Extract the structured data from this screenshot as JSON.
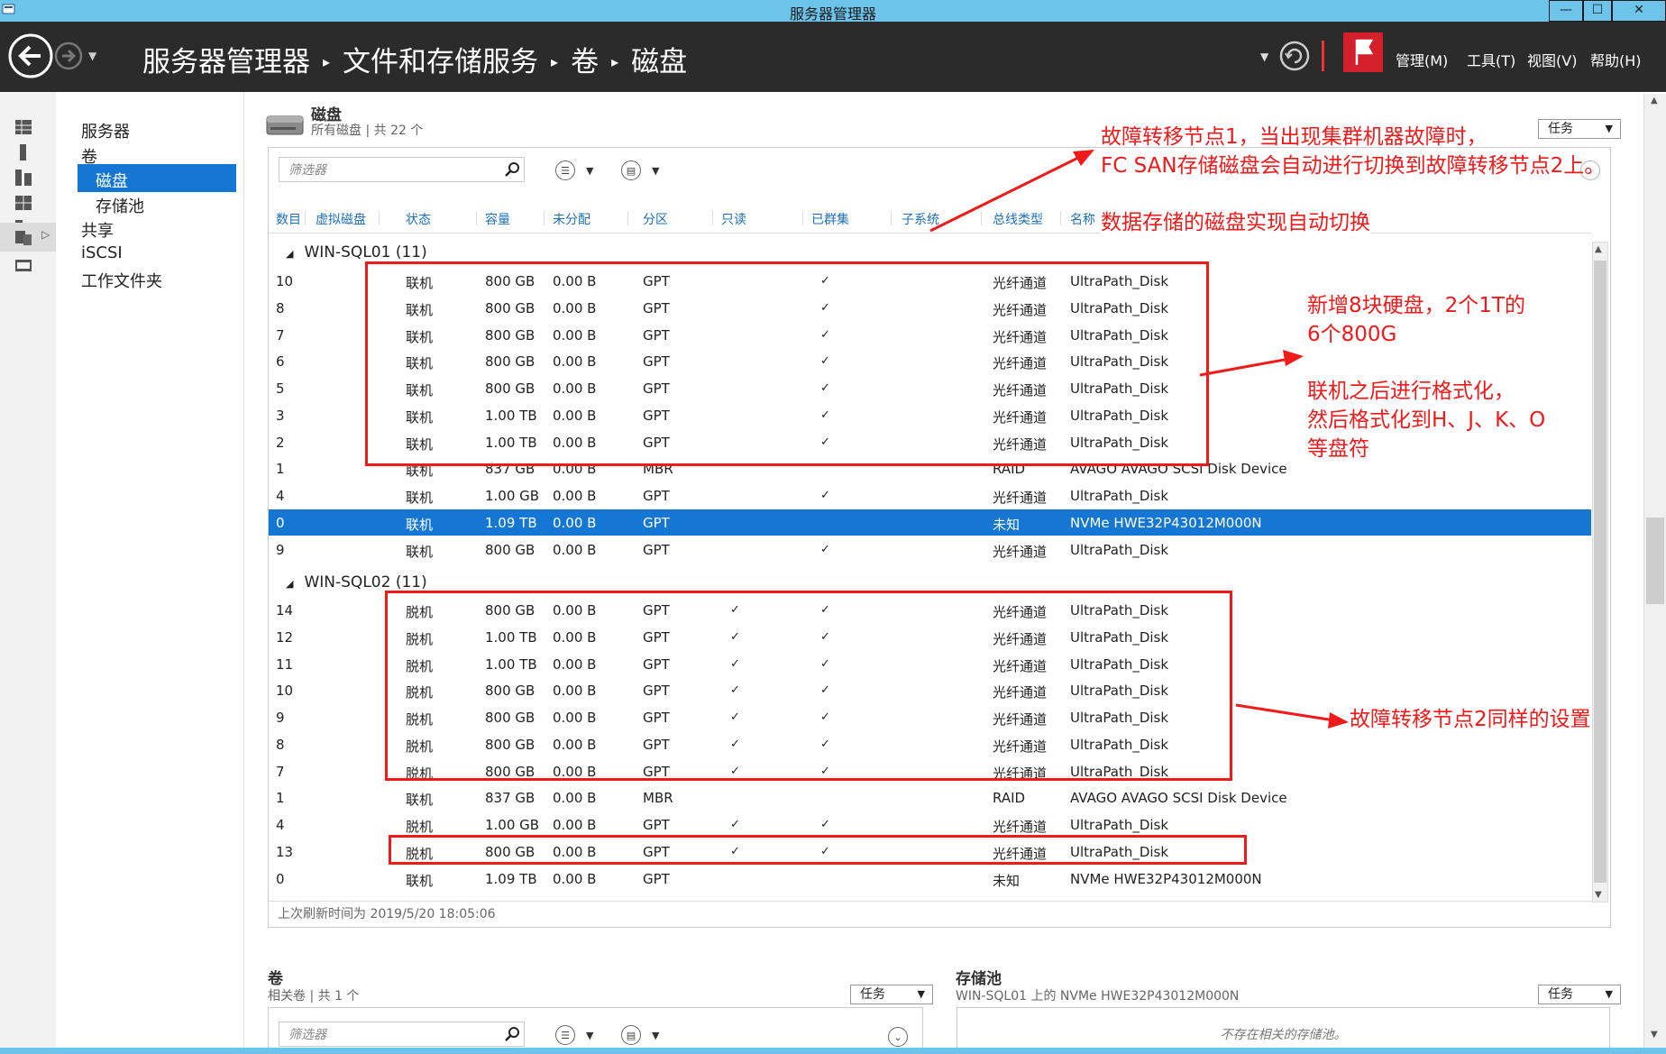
{
  "window": {
    "title": "服务器管理器",
    "min": "—",
    "max": "☐",
    "close": "✕"
  },
  "header": {
    "breadcrumb": [
      "服务器管理器",
      "文件和存储服务",
      "卷",
      "磁盘"
    ],
    "separator": "▸",
    "menus": [
      "管理(M)",
      "工具(T)",
      "视图(V)",
      "帮助(H)"
    ]
  },
  "nav": {
    "items": [
      {
        "label": "服务器"
      },
      {
        "label": "卷"
      },
      {
        "label": "磁盘"
      },
      {
        "label": "存储池"
      },
      {
        "label": "共享"
      },
      {
        "label": "iSCSI"
      },
      {
        "label": "工作文件夹"
      }
    ]
  },
  "disks": {
    "title": "磁盘",
    "subtitle": "所有磁盘 | 共 22 个",
    "tasks_label": "任务",
    "filter_placeholder": "筛选器",
    "columns": [
      "数目",
      "虚拟磁盘",
      "状态",
      "容量",
      "未分配",
      "分区",
      "只读",
      "已群集",
      "子系统",
      "总线类型",
      "名称"
    ],
    "groups": [
      {
        "label": "WIN-SQL01 (11)",
        "rows": [
          {
            "num": "10",
            "status": "联机",
            "cap": "800 GB",
            "unalloc": "0.00 B",
            "part": "GPT",
            "ro": "",
            "clustered": "✓",
            "bus": "光纤通道",
            "name": "UltraPath_Disk"
          },
          {
            "num": "8",
            "status": "联机",
            "cap": "800 GB",
            "unalloc": "0.00 B",
            "part": "GPT",
            "ro": "",
            "clustered": "✓",
            "bus": "光纤通道",
            "name": "UltraPath_Disk"
          },
          {
            "num": "7",
            "status": "联机",
            "cap": "800 GB",
            "unalloc": "0.00 B",
            "part": "GPT",
            "ro": "",
            "clustered": "✓",
            "bus": "光纤通道",
            "name": "UltraPath_Disk"
          },
          {
            "num": "6",
            "status": "联机",
            "cap": "800 GB",
            "unalloc": "0.00 B",
            "part": "GPT",
            "ro": "",
            "clustered": "✓",
            "bus": "光纤通道",
            "name": "UltraPath_Disk"
          },
          {
            "num": "5",
            "status": "联机",
            "cap": "800 GB",
            "unalloc": "0.00 B",
            "part": "GPT",
            "ro": "",
            "clustered": "✓",
            "bus": "光纤通道",
            "name": "UltraPath_Disk"
          },
          {
            "num": "3",
            "status": "联机",
            "cap": "1.00 TB",
            "unalloc": "0.00 B",
            "part": "GPT",
            "ro": "",
            "clustered": "✓",
            "bus": "光纤通道",
            "name": "UltraPath_Disk"
          },
          {
            "num": "2",
            "status": "联机",
            "cap": "1.00 TB",
            "unalloc": "0.00 B",
            "part": "GPT",
            "ro": "",
            "clustered": "✓",
            "bus": "光纤通道",
            "name": "UltraPath_Disk"
          },
          {
            "num": "1",
            "status": "联机",
            "cap": "837 GB",
            "unalloc": "0.00 B",
            "part": "MBR",
            "ro": "",
            "clustered": "",
            "bus": "RAID",
            "name": "AVAGO AVAGO SCSI Disk Device"
          },
          {
            "num": "4",
            "status": "联机",
            "cap": "1.00 GB",
            "unalloc": "0.00 B",
            "part": "GPT",
            "ro": "",
            "clustered": "✓",
            "bus": "光纤通道",
            "name": "UltraPath_Disk"
          },
          {
            "num": "0",
            "status": "联机",
            "cap": "1.09 TB",
            "unalloc": "0.00 B",
            "part": "GPT",
            "ro": "",
            "clustered": "",
            "bus": "未知",
            "name": "NVMe HWE32P43012M000N",
            "selected": true
          },
          {
            "num": "9",
            "status": "联机",
            "cap": "800 GB",
            "unalloc": "0.00 B",
            "part": "GPT",
            "ro": "",
            "clustered": "✓",
            "bus": "光纤通道",
            "name": "UltraPath_Disk"
          }
        ]
      },
      {
        "label": "WIN-SQL02 (11)",
        "rows": [
          {
            "num": "14",
            "status": "脱机",
            "cap": "800 GB",
            "unalloc": "0.00 B",
            "part": "GPT",
            "ro": "✓",
            "clustered": "✓",
            "bus": "光纤通道",
            "name": "UltraPath_Disk"
          },
          {
            "num": "12",
            "status": "脱机",
            "cap": "1.00 TB",
            "unalloc": "0.00 B",
            "part": "GPT",
            "ro": "✓",
            "clustered": "✓",
            "bus": "光纤通道",
            "name": "UltraPath_Disk"
          },
          {
            "num": "11",
            "status": "脱机",
            "cap": "1.00 TB",
            "unalloc": "0.00 B",
            "part": "GPT",
            "ro": "✓",
            "clustered": "✓",
            "bus": "光纤通道",
            "name": "UltraPath_Disk"
          },
          {
            "num": "10",
            "status": "脱机",
            "cap": "800 GB",
            "unalloc": "0.00 B",
            "part": "GPT",
            "ro": "✓",
            "clustered": "✓",
            "bus": "光纤通道",
            "name": "UltraPath_Disk"
          },
          {
            "num": "9",
            "status": "脱机",
            "cap": "800 GB",
            "unalloc": "0.00 B",
            "part": "GPT",
            "ro": "✓",
            "clustered": "✓",
            "bus": "光纤通道",
            "name": "UltraPath_Disk"
          },
          {
            "num": "8",
            "status": "脱机",
            "cap": "800 GB",
            "unalloc": "0.00 B",
            "part": "GPT",
            "ro": "✓",
            "clustered": "✓",
            "bus": "光纤通道",
            "name": "UltraPath_Disk"
          },
          {
            "num": "7",
            "status": "脱机",
            "cap": "800 GB",
            "unalloc": "0.00 B",
            "part": "GPT",
            "ro": "✓",
            "clustered": "✓",
            "bus": "光纤通道",
            "name": "UltraPath_Disk"
          },
          {
            "num": "1",
            "status": "联机",
            "cap": "837 GB",
            "unalloc": "0.00 B",
            "part": "MBR",
            "ro": "",
            "clustered": "",
            "bus": "RAID",
            "name": "AVAGO AVAGO SCSI Disk Device"
          },
          {
            "num": "4",
            "status": "脱机",
            "cap": "1.00 GB",
            "unalloc": "0.00 B",
            "part": "GPT",
            "ro": "✓",
            "clustered": "✓",
            "bus": "光纤通道",
            "name": "UltraPath_Disk"
          },
          {
            "num": "13",
            "status": "脱机",
            "cap": "800 GB",
            "unalloc": "0.00 B",
            "part": "GPT",
            "ro": "✓",
            "clustered": "✓",
            "bus": "光纤通道",
            "name": "UltraPath_Disk"
          },
          {
            "num": "0",
            "status": "联机",
            "cap": "1.09 TB",
            "unalloc": "0.00 B",
            "part": "GPT",
            "ro": "",
            "clustered": "",
            "bus": "未知",
            "name": "NVMe HWE32P43012M000N"
          }
        ]
      }
    ],
    "last_refresh": "上次刷新时间为 2019/5/20 18:05:06"
  },
  "volumes": {
    "title": "卷",
    "subtitle": "相关卷 | 共 1 个",
    "tasks_label": "任务",
    "filter_placeholder": "筛选器"
  },
  "storage_pool": {
    "title": "存储池",
    "subtitle": "WIN-SQL01 上的 NVMe HWE32P43012M000N",
    "tasks_label": "任务",
    "empty_message": "不存在相关的存储池。"
  },
  "annotations": {
    "a1_line1": "故障转移节点1，当出现集群机器故障时，",
    "a1_line2": "FC SAN存储磁盘会自动进行切换到故障转移节点2上。",
    "a2": "数据存储的磁盘实现自动切换",
    "a3_line1": "新增8块硬盘，2个1T的",
    "a3_line2": "6个800G",
    "a4_line1": "联机之后进行格式化，",
    "a4_line2": "然后格式化到H、J、K、O",
    "a4_line3": "等盘符",
    "a5": "故障转移节点2同样的设置"
  },
  "colors": {
    "accent": "#1577d3",
    "annotation": "#ef1a1a",
    "titlebar": "#6cc4ea",
    "header": "#2b2b2b",
    "flag": "#d3202a"
  }
}
